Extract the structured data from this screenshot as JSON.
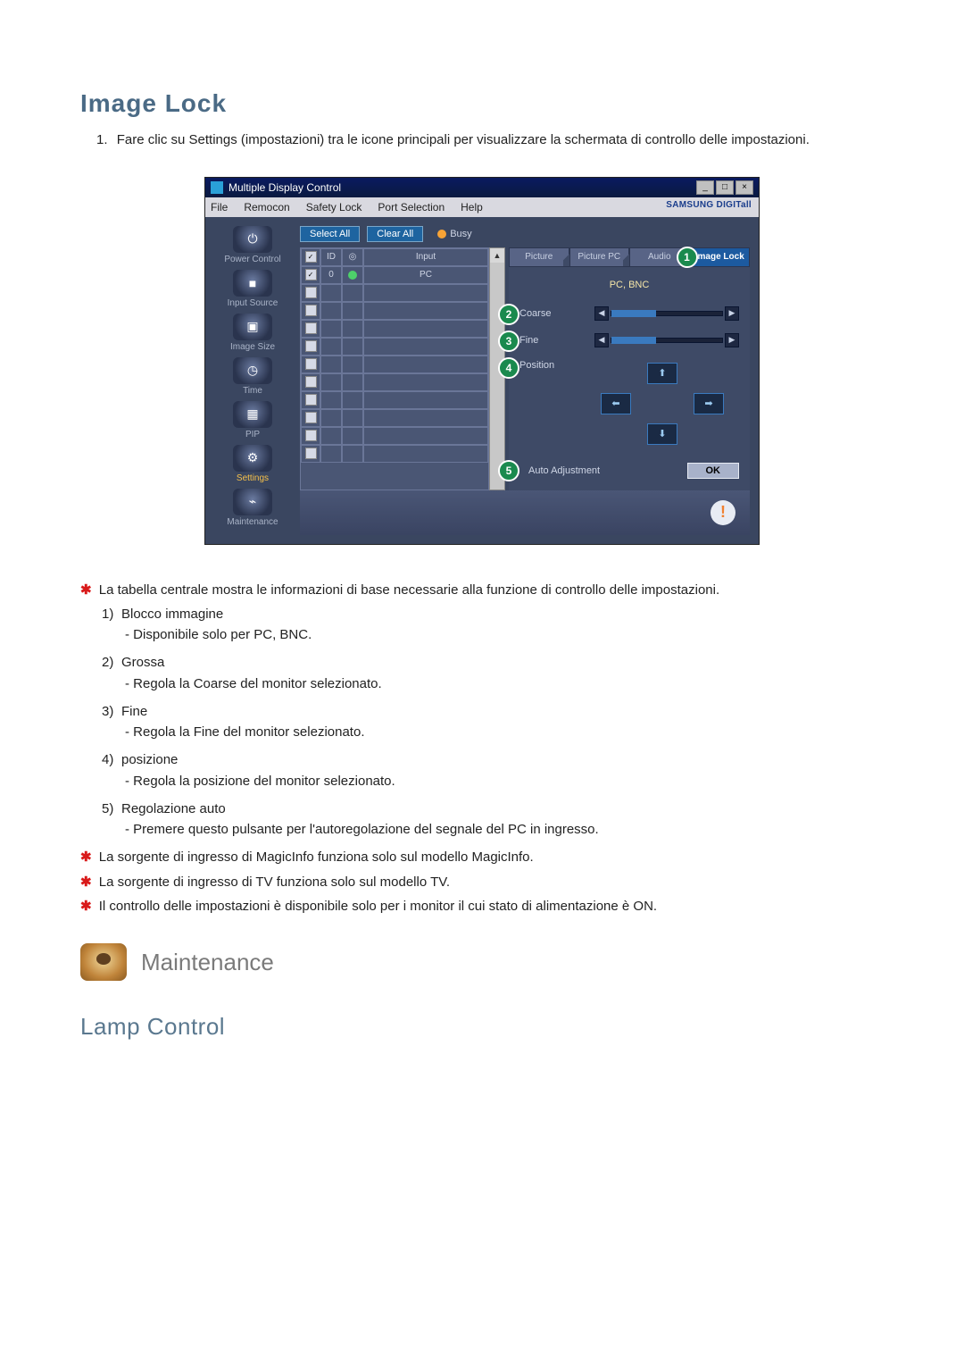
{
  "doc": {
    "section_title": "Image Lock",
    "intro_num": "1.",
    "intro_text": "Fare clic su Settings (impostazioni) tra le icone principali per visualizzare la schermata di controllo delle impostazioni.",
    "star_top": "La tabella centrale mostra le informazioni di base necessarie alla funzione di controllo delle impostazioni.",
    "items": [
      {
        "num": "1)",
        "title": "Blocco immagine",
        "sub_prefix": "-",
        "sub": "Disponibile solo per PC, BNC."
      },
      {
        "num": "2)",
        "title": "Grossa",
        "sub_prefix": "-",
        "sub": "Regola la Coarse del monitor selezionato."
      },
      {
        "num": "3)",
        "title": "Fine",
        "sub_prefix": "-",
        "sub": "Regola la Fine del monitor selezionato."
      },
      {
        "num": "4)",
        "title": "posizione",
        "sub_prefix": "-",
        "sub": "Regola la posizione del monitor selezionato."
      },
      {
        "num": "5)",
        "title": "Regolazione auto",
        "sub_prefix": "-",
        "sub": "Premere questo pulsante per l'autoregolazione del segnale del PC in ingresso."
      }
    ],
    "star_notes": [
      "La sorgente di ingresso di MagicInfo funziona solo sul modello MagicInfo.",
      "La sorgente di ingresso di TV funziona solo sul modello TV.",
      "Il controllo delle impostazioni è disponibile solo per i monitor il cui stato di alimentazione è ON."
    ],
    "maintenance_heading": "Maintenance",
    "sub_section_title": "Lamp Control"
  },
  "app": {
    "window_title": "Multiple Display Control",
    "brand": "SAMSUNG DIGITall",
    "menu": [
      "File",
      "Remocon",
      "Safety Lock",
      "Port Selection",
      "Help"
    ],
    "sidebar": [
      {
        "label": "Power Control",
        "icon": "⏻"
      },
      {
        "label": "Input Source",
        "icon": "■"
      },
      {
        "label": "Image Size",
        "icon": "▣"
      },
      {
        "label": "Time",
        "icon": "◷"
      },
      {
        "label": "PIP",
        "icon": "▦"
      },
      {
        "label": "Settings",
        "icon": "⚙",
        "active": true
      },
      {
        "label": "Maintenance",
        "icon": "⌁"
      }
    ],
    "toolbar": {
      "select_all": "Select All",
      "clear_all": "Clear All",
      "busy": "Busy"
    },
    "grid": {
      "headers": {
        "chk": "",
        "id": "ID",
        "st": "",
        "input": "Input"
      },
      "rows": [
        {
          "checked": true,
          "id": "0",
          "status": "green",
          "input": "PC"
        }
      ],
      "empty_rows": 10
    },
    "tabs": [
      "Picture",
      "Picture PC",
      "Audio",
      "Image Lock"
    ],
    "active_tab": 3,
    "panel": {
      "subtitle": "PC, BNC",
      "coarse": "Coarse",
      "fine": "Fine",
      "position": "Position",
      "auto": "Auto Adjustment",
      "ok": "OK"
    },
    "callouts": {
      "one": "1",
      "two": "2",
      "three": "3",
      "four": "4",
      "five": "5"
    }
  }
}
